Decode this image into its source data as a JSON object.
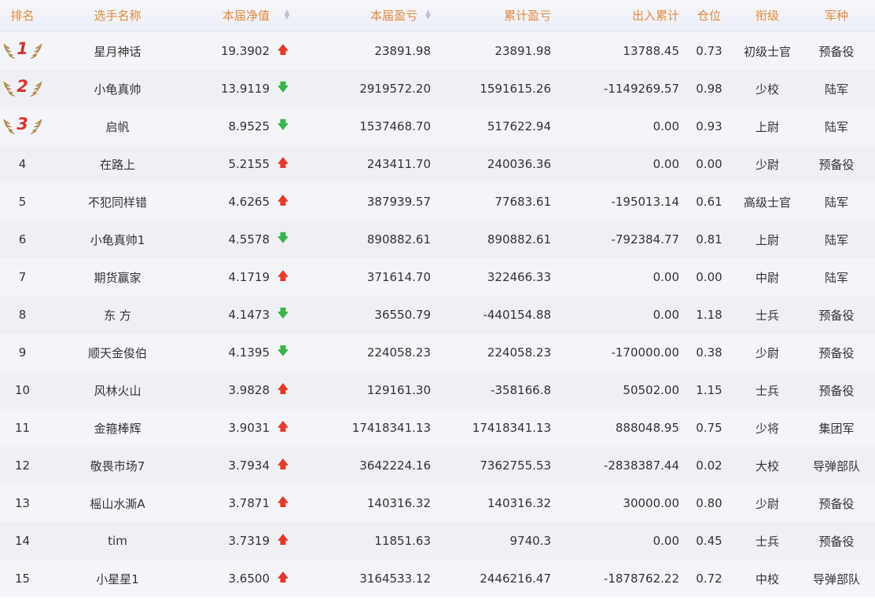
{
  "colors": {
    "header_text": "#e08a3a",
    "up": "#e23a2a",
    "down": "#3bb24a",
    "rank_badge": "#d9342b"
  },
  "header": {
    "rank": "排名",
    "name": "选手名称",
    "nav": "本届净值",
    "pnl": "本届盈亏",
    "cumulative": "累计盈亏",
    "flow": "出入累计",
    "position": "仓位",
    "grade": "衔级",
    "arm": "军种"
  },
  "rows": [
    {
      "rank": "1",
      "name": "星月神话",
      "nav": "19.3902",
      "trend": "up",
      "pnl": "23891.98",
      "cumulative": "23891.98",
      "flow": "13788.45",
      "position": "0.73",
      "grade": "初级士官",
      "arm": "预备役"
    },
    {
      "rank": "2",
      "name": "小龟真帅",
      "nav": "13.9119",
      "trend": "down",
      "pnl": "2919572.20",
      "cumulative": "1591615.26",
      "flow": "-1149269.57",
      "position": "0.98",
      "grade": "少校",
      "arm": "陆军"
    },
    {
      "rank": "3",
      "name": "启帆",
      "nav": "8.9525",
      "trend": "down",
      "pnl": "1537468.70",
      "cumulative": "517622.94",
      "flow": "0.00",
      "position": "0.93",
      "grade": "上尉",
      "arm": "陆军"
    },
    {
      "rank": "4",
      "name": "在路上",
      "nav": "5.2155",
      "trend": "up",
      "pnl": "243411.70",
      "cumulative": "240036.36",
      "flow": "0.00",
      "position": "0.00",
      "grade": "少尉",
      "arm": "预备役"
    },
    {
      "rank": "5",
      "name": "不犯同样错",
      "nav": "4.6265",
      "trend": "up",
      "pnl": "387939.57",
      "cumulative": "77683.61",
      "flow": "-195013.14",
      "position": "0.61",
      "grade": "高级士官",
      "arm": "陆军"
    },
    {
      "rank": "6",
      "name": "小龟真帅1",
      "nav": "4.5578",
      "trend": "down",
      "pnl": "890882.61",
      "cumulative": "890882.61",
      "flow": "-792384.77",
      "position": "0.81",
      "grade": "上尉",
      "arm": "陆军"
    },
    {
      "rank": "7",
      "name": "期货赢家",
      "nav": "4.1719",
      "trend": "up",
      "pnl": "371614.70",
      "cumulative": "322466.33",
      "flow": "0.00",
      "position": "0.00",
      "grade": "中尉",
      "arm": "陆军"
    },
    {
      "rank": "8",
      "name": "东 方",
      "nav": "4.1473",
      "trend": "down",
      "pnl": "36550.79",
      "cumulative": "-440154.88",
      "flow": "0.00",
      "position": "1.18",
      "grade": "士兵",
      "arm": "预备役"
    },
    {
      "rank": "9",
      "name": "顺天金俊伯",
      "nav": "4.1395",
      "trend": "down",
      "pnl": "224058.23",
      "cumulative": "224058.23",
      "flow": "-170000.00",
      "position": "0.38",
      "grade": "少尉",
      "arm": "预备役"
    },
    {
      "rank": "10",
      "name": "风林火山",
      "nav": "3.9828",
      "trend": "up",
      "pnl": "129161.30",
      "cumulative": "-358166.8",
      "flow": "50502.00",
      "position": "1.15",
      "grade": "士兵",
      "arm": "预备役"
    },
    {
      "rank": "11",
      "name": "金箍棒辉",
      "nav": "3.9031",
      "trend": "up",
      "pnl": "17418341.13",
      "cumulative": "17418341.13",
      "flow": "888048.95",
      "position": "0.75",
      "grade": "少将",
      "arm": "集团军"
    },
    {
      "rank": "12",
      "name": "敬畏市场7",
      "nav": "3.7934",
      "trend": "up",
      "pnl": "3642224.16",
      "cumulative": "7362755.53",
      "flow": "-2838387.44",
      "position": "0.02",
      "grade": "大校",
      "arm": "导弹部队"
    },
    {
      "rank": "13",
      "name": "榣山水澌A",
      "nav": "3.7871",
      "trend": "up",
      "pnl": "140316.32",
      "cumulative": "140316.32",
      "flow": "30000.00",
      "position": "0.80",
      "grade": "少尉",
      "arm": "预备役"
    },
    {
      "rank": "14",
      "name": "tim",
      "nav": "3.7319",
      "trend": "up",
      "pnl": "11851.63",
      "cumulative": "9740.3",
      "flow": "0.00",
      "position": "0.45",
      "grade": "士兵",
      "arm": "预备役"
    },
    {
      "rank": "15",
      "name": "小星星1",
      "nav": "3.6500",
      "trend": "up",
      "pnl": "3164533.12",
      "cumulative": "2446216.47",
      "flow": "-1878762.22",
      "position": "0.72",
      "grade": "中校",
      "arm": "导弹部队"
    }
  ]
}
